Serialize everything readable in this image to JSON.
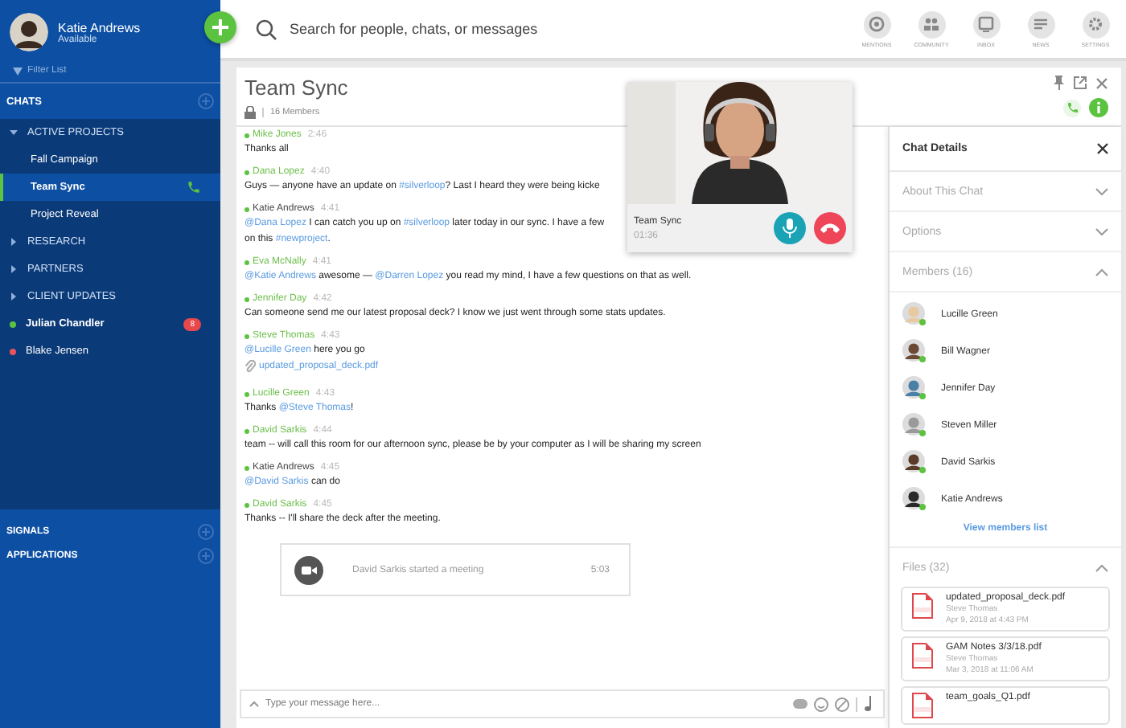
{
  "user": {
    "name": "Katie Andrews",
    "status": "Available"
  },
  "sidebar": {
    "filter_placeholder": "Filter List",
    "section": "CHATS",
    "items": [
      {
        "kind": "group",
        "label": "ACTIVE PROJECTS",
        "expanded": true,
        "children": [
          {
            "kind": "channel",
            "label": "Fall Campaign",
            "selected": false,
            "in_call": false
          },
          {
            "kind": "channel",
            "label": "Team Sync",
            "selected": true,
            "in_call": true
          },
          {
            "kind": "channel",
            "label": "Project Reveal",
            "selected": false,
            "in_call": false
          }
        ]
      },
      {
        "kind": "group",
        "label": "RESEARCH",
        "expanded": false
      },
      {
        "kind": "group",
        "label": "PARTNERS",
        "expanded": false
      },
      {
        "kind": "group",
        "label": "CLIENT UPDATES",
        "expanded": false
      },
      {
        "kind": "person",
        "label": "Julian Chandler",
        "color": "#5cc341",
        "unread": true,
        "badge": "8"
      },
      {
        "kind": "person",
        "label": "Blake Jensen",
        "color": "#e8555e",
        "unread": false
      }
    ],
    "footer": [
      "SIGNALS",
      "APPLICATIONS"
    ]
  },
  "search": {
    "placeholder": "Search for people, chats, or messages"
  },
  "top_nav": [
    "MENTIONS",
    "COMMUNITY",
    "INBOX",
    "NEWS",
    "SETTINGS"
  ],
  "chat": {
    "title": "Team Sync",
    "members": "16 Members",
    "messages": [
      {
        "sender": "Mike Jones",
        "time": "2:46",
        "color": "#6cbf4a",
        "body": [
          {
            "kind": "plain",
            "text": "Thanks all"
          }
        ]
      },
      {
        "sender": "Dana Lopez",
        "time": "4:40",
        "color": "#6cbf4a",
        "body": [
          {
            "kind": "plain",
            "text": "Guys — anyone have an update on "
          },
          {
            "kind": "link",
            "text": "#silverloop"
          },
          {
            "kind": "plain",
            "text": "? Last I heard they were being kicke"
          }
        ]
      },
      {
        "sender": "Katie Andrews",
        "time": "4:41",
        "color": "#444444",
        "body": [
          {
            "kind": "link",
            "text": "@Dana Lopez"
          },
          {
            "kind": "plain",
            "text": " I can catch you up on "
          },
          {
            "kind": "link",
            "text": "#silverloop"
          },
          {
            "kind": "plain",
            "text": " later today in our sync. I have a few"
          },
          {
            "kind": "break"
          },
          {
            "kind": "plain",
            "text": "on this "
          },
          {
            "kind": "link",
            "text": "#newproject"
          },
          {
            "kind": "plain",
            "text": "."
          }
        ]
      },
      {
        "sender": "Eva McNally",
        "time": "4:41",
        "color": "#6cbf4a",
        "body": [
          {
            "kind": "link",
            "text": "@Katie Andrews"
          },
          {
            "kind": "plain",
            "text": " awesome — "
          },
          {
            "kind": "link",
            "text": "@Darren Lopez"
          },
          {
            "kind": "plain",
            "text": " you read my mind, I have a few questions on that as well."
          }
        ]
      },
      {
        "sender": "Jennifer Day",
        "time": "4:42",
        "color": "#6cbf4a",
        "body": [
          {
            "kind": "plain",
            "text": "Can someone send me our latest proposal deck? I know we just went through some stats updates."
          }
        ]
      },
      {
        "sender": "Steve Thomas",
        "time": "4:43",
        "color": "#6cbf4a",
        "body": [
          {
            "kind": "link",
            "text": "@Lucille Green"
          },
          {
            "kind": "plain",
            "text": " here you go"
          },
          {
            "kind": "break"
          },
          {
            "kind": "file",
            "text": "updated_proposal_deck.pdf"
          }
        ]
      },
      {
        "sender": "Lucille Green",
        "time": "4:43",
        "color": "#6cbf4a",
        "body": [
          {
            "kind": "plain",
            "text": "Thanks "
          },
          {
            "kind": "link",
            "text": "@Steve Thomas"
          },
          {
            "kind": "plain",
            "text": "!"
          }
        ]
      },
      {
        "sender": "David Sarkis",
        "time": "4:44",
        "color": "#6cbf4a",
        "body": [
          {
            "kind": "plain",
            "text": "team -- will call this room for our afternoon sync, please be by your computer as I will be sharing my screen"
          }
        ]
      },
      {
        "sender": "Katie Andrews",
        "time": "4:45",
        "color": "#444444",
        "body": [
          {
            "kind": "link",
            "text": "@David Sarkis"
          },
          {
            "kind": "plain",
            "text": " can do"
          }
        ]
      },
      {
        "sender": "David Sarkis",
        "time": "4:45",
        "color": "#6cbf4a",
        "body": [
          {
            "kind": "plain",
            "text": "Thanks -- I'll share the deck after the meeting."
          }
        ]
      }
    ],
    "meeting": {
      "text": "David Sarkis started a meeting",
      "time": "5:03"
    },
    "composer_placeholder": "Type your message here..."
  },
  "call": {
    "name": "Team Sync",
    "duration": "01:36",
    "muted": false
  },
  "details": {
    "title": "Chat Details",
    "sections": [
      {
        "label": "About This Chat",
        "expanded": false
      },
      {
        "label": "Options",
        "expanded": false
      },
      {
        "label": "Members (16)",
        "expanded": true
      }
    ],
    "members": [
      {
        "name": "Lucille Green",
        "color": "#e8c9a0"
      },
      {
        "name": "Bill Wagner",
        "color": "#6b4a35"
      },
      {
        "name": "Jennifer Day",
        "color": "#4a7fa8"
      },
      {
        "name": "Steven Miller",
        "color": "#9a9a9a"
      },
      {
        "name": "David Sarkis",
        "color": "#5a3a28"
      },
      {
        "name": "Katie Andrews",
        "color": "#2a2a2a"
      }
    ],
    "view_members": "View members list",
    "files_label": "Files (32)",
    "files_expanded": true,
    "files": [
      {
        "name": "updated_proposal_deck.pdf",
        "author": "Steve Thomas",
        "date": "Apr 9, 2018 at 4:43 PM"
      },
      {
        "name": "GAM Notes 3/3/18.pdf",
        "author": "Steve Thomas",
        "date": "Mar 3, 2018 at 11:06 AM"
      },
      {
        "name": "team_goals_Q1.pdf"
      }
    ]
  }
}
